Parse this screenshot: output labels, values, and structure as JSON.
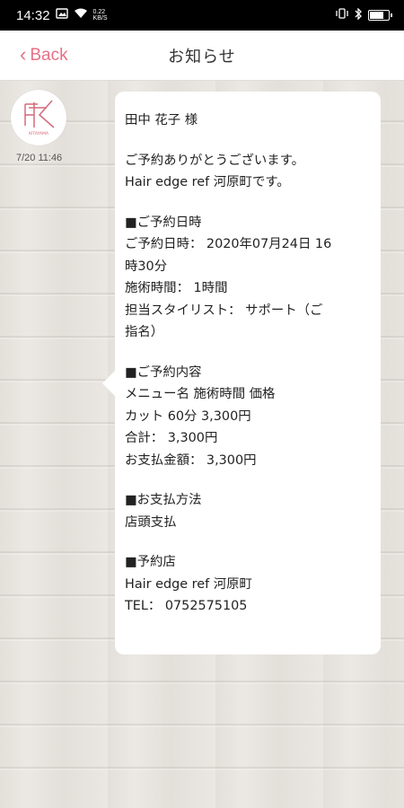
{
  "status_bar": {
    "time": "14:32",
    "net_speed_value": "0.22",
    "net_speed_unit": "KB/S"
  },
  "nav": {
    "back_label": "Back",
    "title": "お知らせ"
  },
  "message": {
    "timestamp": "7/20 11:46",
    "avatar_text": "KITAYAMA",
    "accent_color": "#e76f86",
    "blocks": [
      [
        "田中 花子 様"
      ],
      [
        "ご予約ありがとうございます。",
        "Hair edge ref 河原町です。"
      ],
      [
        "■ご予約日時",
        "ご予約日時： 2020年07月24日 16",
        "時30分",
        "施術時間： 1時間",
        "担当スタイリスト： サポート（ご",
        "指名）"
      ],
      [
        "■ご予約内容",
        "メニュー名 施術時間 価格",
        "カット 60分 3,300円",
        "合計： 3,300円",
        "お支払金額： 3,300円"
      ],
      [
        "■お支払方法",
        "店頭支払"
      ],
      [
        "■予約店",
        "Hair edge ref 河原町",
        "TEL： 0752575105"
      ]
    ]
  }
}
